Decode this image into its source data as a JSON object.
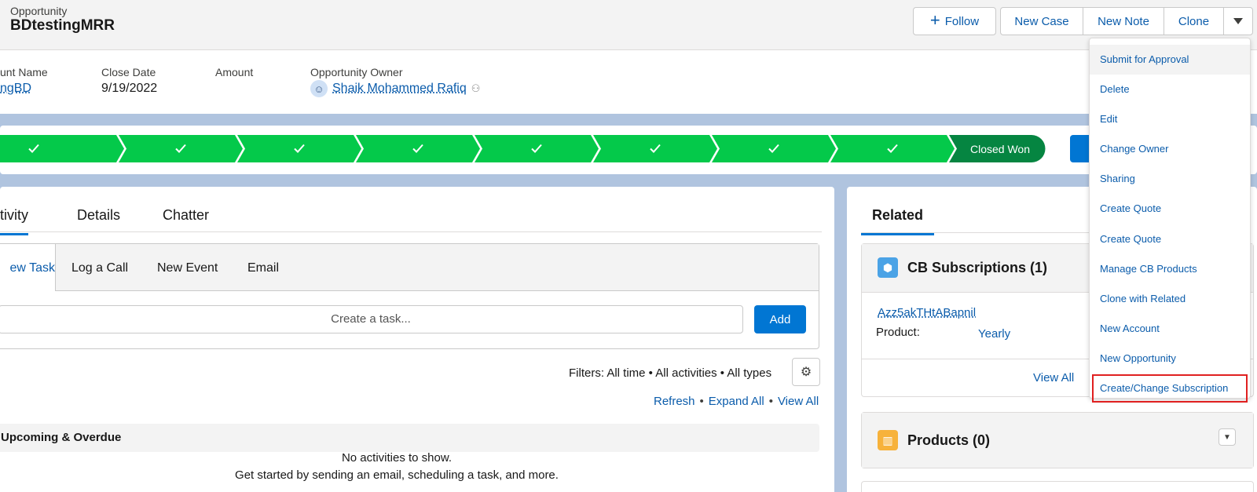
{
  "header": {
    "object_label": "Opportunity",
    "record_title": "BDtestingMRR",
    "follow_label": "Follow",
    "new_case_label": "New Case",
    "new_note_label": "New Note",
    "clone_label": "Clone"
  },
  "highlights": {
    "account_label": "unt Name",
    "account_value": "ngBD",
    "close_date_label": "Close Date",
    "close_date_value": "9/19/2022",
    "amount_label": "Amount",
    "owner_label": "Opportunity Owner",
    "owner_value": "Shaik Mohammed Rafiq"
  },
  "path": {
    "completed_step_count": 8,
    "final_stage": "Closed Won",
    "colors": {
      "complete": "#04c94a",
      "won": "#058541"
    }
  },
  "activity": {
    "tabs": [
      "tivity",
      "Details",
      "Chatter"
    ],
    "publisher_tabs": [
      "ew Task",
      "Log a Call",
      "New Event",
      "Email"
    ],
    "task_placeholder": "Create a task...",
    "add_label": "Add",
    "filters_text": "Filters: All time • All activities • All types",
    "links": [
      "Refresh",
      "Expand All",
      "View All"
    ],
    "upcoming_label": "Upcoming & Overdue",
    "no_activities": "No activities to show.",
    "get_started": "Get started by sending an email, scheduling a task, and more."
  },
  "related": {
    "tab_label": "Related",
    "subscriptions": {
      "title": "CB Subscriptions (1)",
      "record_link": "Azz5akTHtABapnil",
      "product_label": "Product:",
      "product_value": "Yearly",
      "view_all": "View All"
    },
    "products": {
      "title": "Products (0)"
    }
  },
  "menu": {
    "items": [
      "Submit for Approval",
      "Delete",
      "Edit",
      "Change Owner",
      "Sharing",
      "Create Quote",
      "Create Quote",
      "Manage CB Products",
      "Clone with Related",
      "New Account",
      "New Opportunity",
      "Create/Change Subscription"
    ],
    "highlight_color": "#e02020"
  }
}
